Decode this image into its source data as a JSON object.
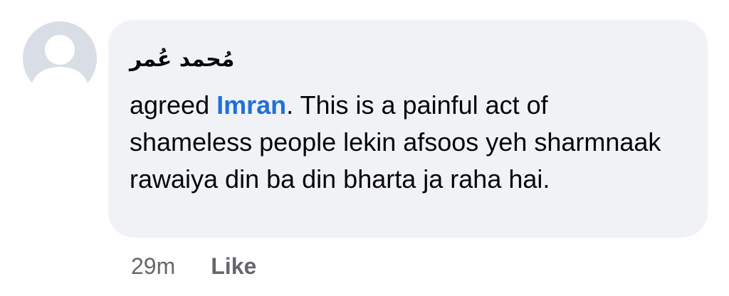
{
  "comment": {
    "author": "مُحمد عُمر",
    "avatar_icon": "default-profile-silhouette-icon",
    "text_before_mention": "agreed ",
    "mention": "Imran",
    "text_after_mention": ". This is a painful act of shameless people lekin afsoos yeh sharmnaak rawaiya din ba din bharta ja raha hai."
  },
  "actions": {
    "timestamp": "29m",
    "like_label": "Like"
  },
  "colors": {
    "bubble_background": "#f0f2f5",
    "mention": "#216fdb",
    "meta_text": "#65676b",
    "avatar_background": "#d8dde6"
  }
}
